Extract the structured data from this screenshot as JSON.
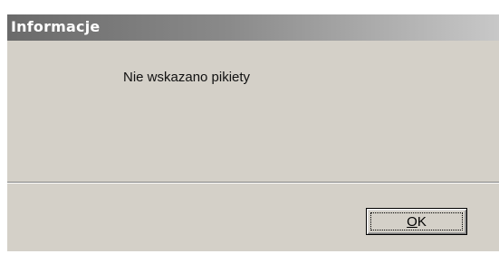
{
  "dialog": {
    "title": "Informacje",
    "message": "Nie wskazano pikiety",
    "ok_button": {
      "label_accel": "O",
      "label_rest": "K"
    }
  },
  "colors": {
    "dialog_face": "#d4d0c8",
    "title_gradient_start": "#6a6a6a",
    "title_gradient_end": "#c8c8c8",
    "title_text": "#ffffff"
  }
}
